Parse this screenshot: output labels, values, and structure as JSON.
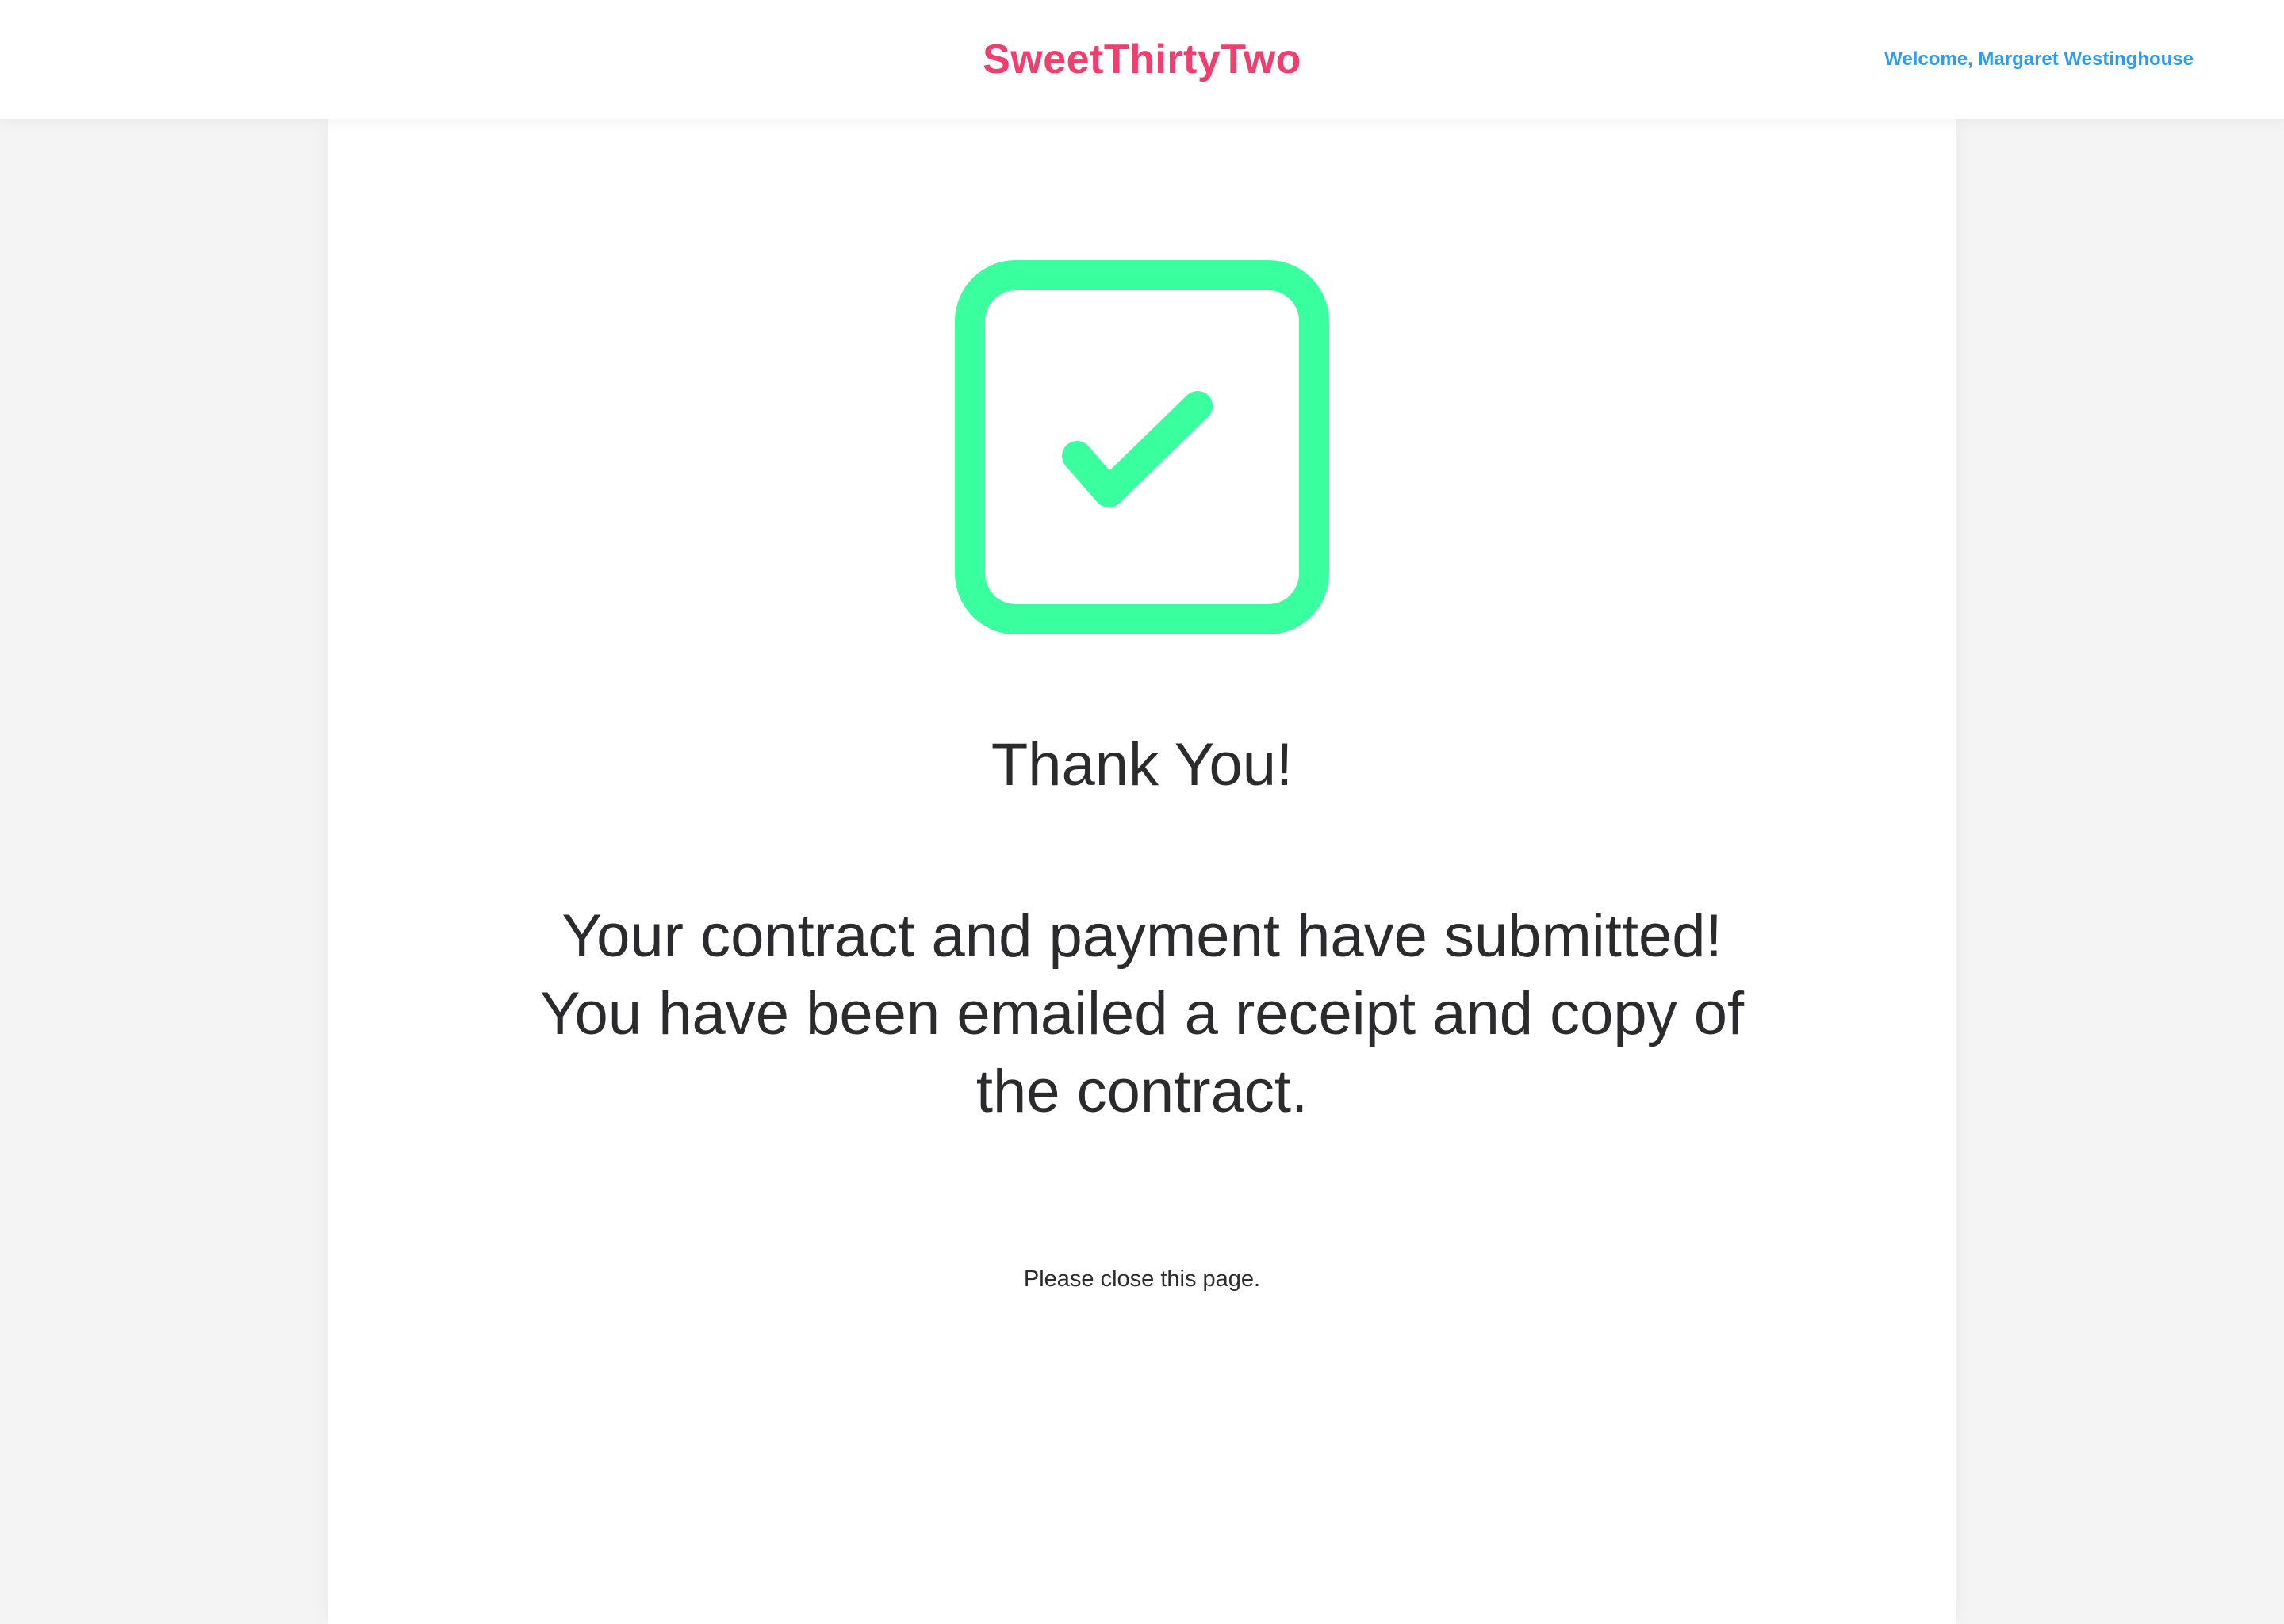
{
  "header": {
    "brand": "SweetThirtyTwo",
    "welcome": "Welcome, Margaret Westinghouse"
  },
  "confirmation": {
    "icon": "checkbox-check-icon",
    "title": "Thank You!",
    "message_line1": "Your contract and payment have submitted!",
    "message_line2": "You have been emailed a receipt and copy of the contract.",
    "close_note": "Please close this page."
  },
  "colors": {
    "brand": "#f03e6e",
    "welcome_link": "#2e9bf0",
    "success": "#39ff9f",
    "text": "#2b2b2d",
    "background": "#f4f4f4"
  }
}
